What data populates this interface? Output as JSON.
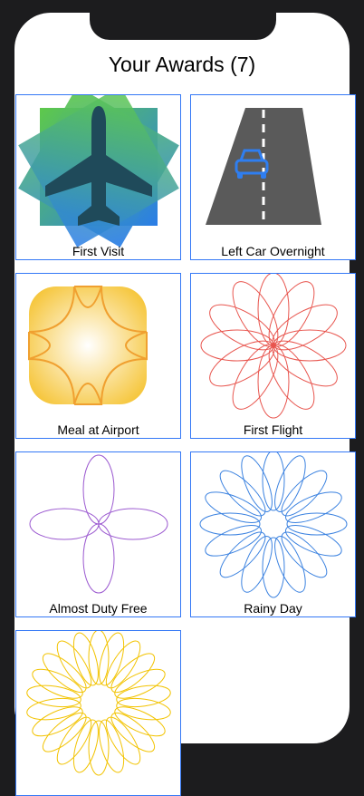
{
  "header": {
    "title": "Your Awards (7)"
  },
  "awards": [
    {
      "label": "First Visit",
      "icon": "airplane-icon"
    },
    {
      "label": "Left Car Overnight",
      "icon": "car-road-icon"
    },
    {
      "label": "Meal at Airport",
      "icon": "meal-icon"
    },
    {
      "label": "First Flight",
      "icon": "flower-red-icon"
    },
    {
      "label": "Almost Duty Free",
      "icon": "flower-purple-icon"
    },
    {
      "label": "Rainy Day",
      "icon": "flower-blue-icon"
    },
    {
      "label": "",
      "icon": "flower-yellow-icon"
    }
  ],
  "colors": {
    "accent": "#3478f6",
    "red": "#e8554e",
    "purple": "#9b59d0",
    "blue": "#3b82e0",
    "yellow": "#f2c300",
    "gold": "#f5a623"
  }
}
